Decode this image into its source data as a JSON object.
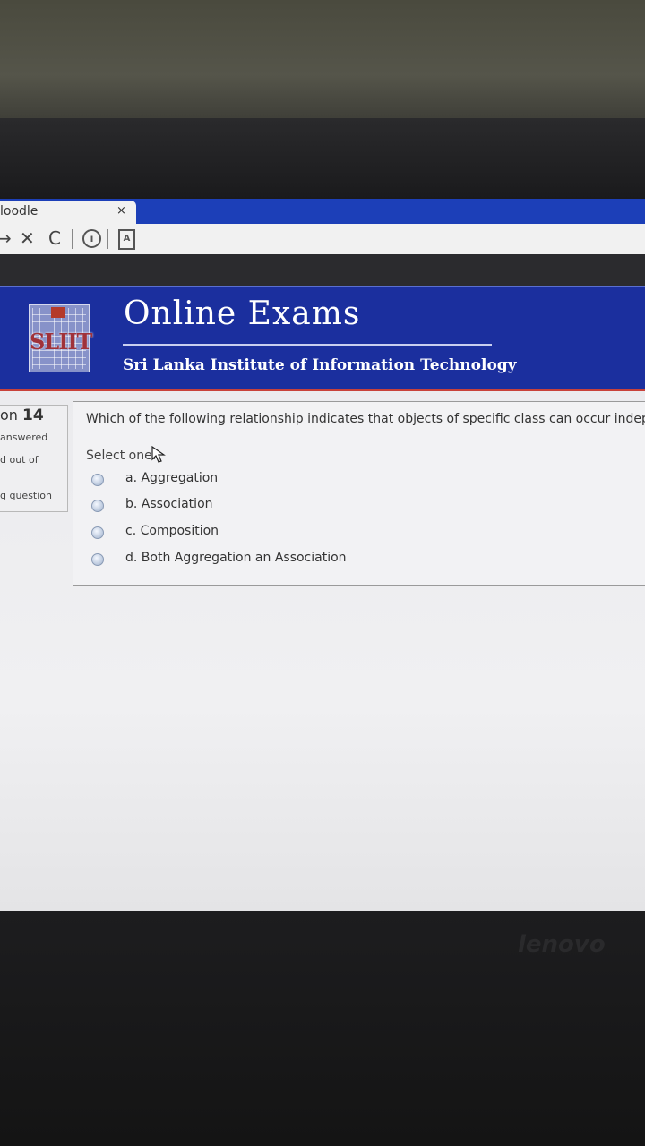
{
  "browser": {
    "tab_title": "loodle",
    "tab_close": "×",
    "nav": {
      "back_icon": "→",
      "stop_icon": "✕",
      "reload_icon": "C",
      "info_icon": "i",
      "reader_icon": "A"
    }
  },
  "header": {
    "logo_text": "SLIIT",
    "title": "Online Exams",
    "subtitle": "Sri Lanka Institute of Information Technology"
  },
  "question_info": {
    "number_prefix": "on",
    "number": "14",
    "status": "answered",
    "marks": "d out of",
    "flag": "g question"
  },
  "question": {
    "text": "Which of the following relationship indicates that objects of specific class can occur indep",
    "select_label": "Select one:",
    "options": [
      {
        "label": "a. Aggregation"
      },
      {
        "label": "b. Association"
      },
      {
        "label": "c. Composition"
      },
      {
        "label": "d. Both Aggregation an Association"
      }
    ]
  },
  "device": {
    "brand": "lenovo"
  }
}
